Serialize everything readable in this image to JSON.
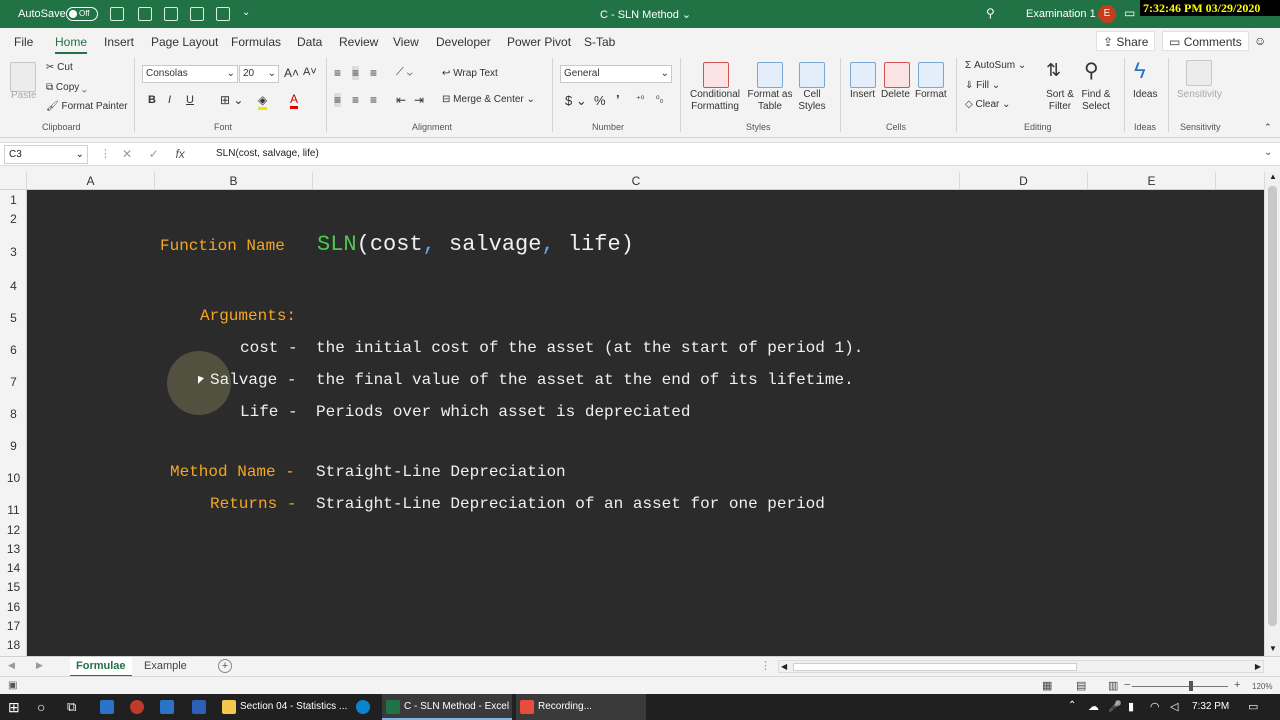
{
  "titlebar": {
    "autosave_label": "AutoSave",
    "autosave_state": "Off",
    "doc_title": "C - SLN Method",
    "search_icon": "search-icon",
    "user_name": "Examination 1",
    "avatar_initial": "E",
    "clock": "7:32:46 PM 03/29/2020"
  },
  "menu": {
    "tabs": [
      "File",
      "Home",
      "Insert",
      "Page Layout",
      "Formulas",
      "Data",
      "Review",
      "View",
      "Developer",
      "Power Pivot",
      "S-Tab"
    ],
    "active": "Home",
    "share": "Share",
    "comments": "Comments"
  },
  "ribbon": {
    "clipboard": {
      "paste": "Paste",
      "cut": "Cut",
      "copy": "Copy",
      "format_painter": "Format Painter",
      "label": "Clipboard"
    },
    "font": {
      "name": "Consolas",
      "size": "20",
      "bold": "B",
      "italic": "I",
      "underline": "U",
      "label": "Font",
      "grow": "A˄",
      "shrink": "A˅"
    },
    "alignment": {
      "wrap": "Wrap Text",
      "merge": "Merge & Center",
      "label": "Alignment"
    },
    "number": {
      "format": "General",
      "currency": "$",
      "percent": "%",
      "comma": "’",
      "label": "Number"
    },
    "styles": {
      "conditional": "Conditional Formatting",
      "format_table": "Format as Table",
      "cell_styles": "Cell Styles",
      "label": "Styles"
    },
    "cells": {
      "insert": "Insert",
      "delete": "Delete",
      "format": "Format",
      "label": "Cells"
    },
    "editing": {
      "autosum": "AutoSum",
      "fill": "Fill",
      "clear": "Clear",
      "sort": "Sort & Filter",
      "find": "Find & Select",
      "label": "Editing"
    },
    "ideas": {
      "button": "Ideas",
      "label": "Ideas"
    },
    "sensitivity": {
      "button": "Sensitivity",
      "label": "Sensitivity"
    }
  },
  "formula_bar": {
    "name_box": "C3",
    "fx": "fx",
    "formula": "SLN(cost, salvage, life)"
  },
  "grid": {
    "columns": [
      "A",
      "B",
      "C",
      "D",
      "E"
    ],
    "rows": [
      "1",
      "2",
      "3",
      "4",
      "5",
      "6",
      "7",
      "8",
      "9",
      "10",
      "11",
      "12",
      "13",
      "14",
      "15",
      "16",
      "17",
      "18"
    ]
  },
  "sheet_content": {
    "function_label": "Function Name",
    "fn_name": "SLN",
    "fn_open": "(",
    "arg1": "cost",
    "comma1": ",",
    "arg2": " salvage",
    "comma2": ",",
    "arg3": " life",
    "fn_close": ")",
    "arguments_label": "Arguments:",
    "cost_label": "cost -",
    "cost_desc": "the initial cost of the asset (at the start of period 1).",
    "salvage_label": "Salvage -",
    "salvage_desc": "the final value of the asset at the end of its lifetime.",
    "life_label": "Life -",
    "life_desc": "Periods over which asset is depreciated",
    "method_label": "Method Name -",
    "method_value": "Straight-Line Depreciation",
    "returns_label": "Returns -",
    "returns_value": "Straight-Line Depreciation of an asset for one period",
    "colors": {
      "label": "#f5a623",
      "function": "#4ec94e",
      "punct": "#5ca8e8",
      "text": "#f0f0f0",
      "background": "#2b2b2b"
    }
  },
  "sheet_tabs": {
    "tabs": [
      "Formulae",
      "Example"
    ],
    "active": "Formulae"
  },
  "statusbar": {
    "zoom": "120%"
  },
  "taskbar": {
    "items": [
      "Section 04 - Statistics ...",
      "C - SLN Method - Excel",
      "Recording..."
    ],
    "time": "7:32 PM"
  }
}
